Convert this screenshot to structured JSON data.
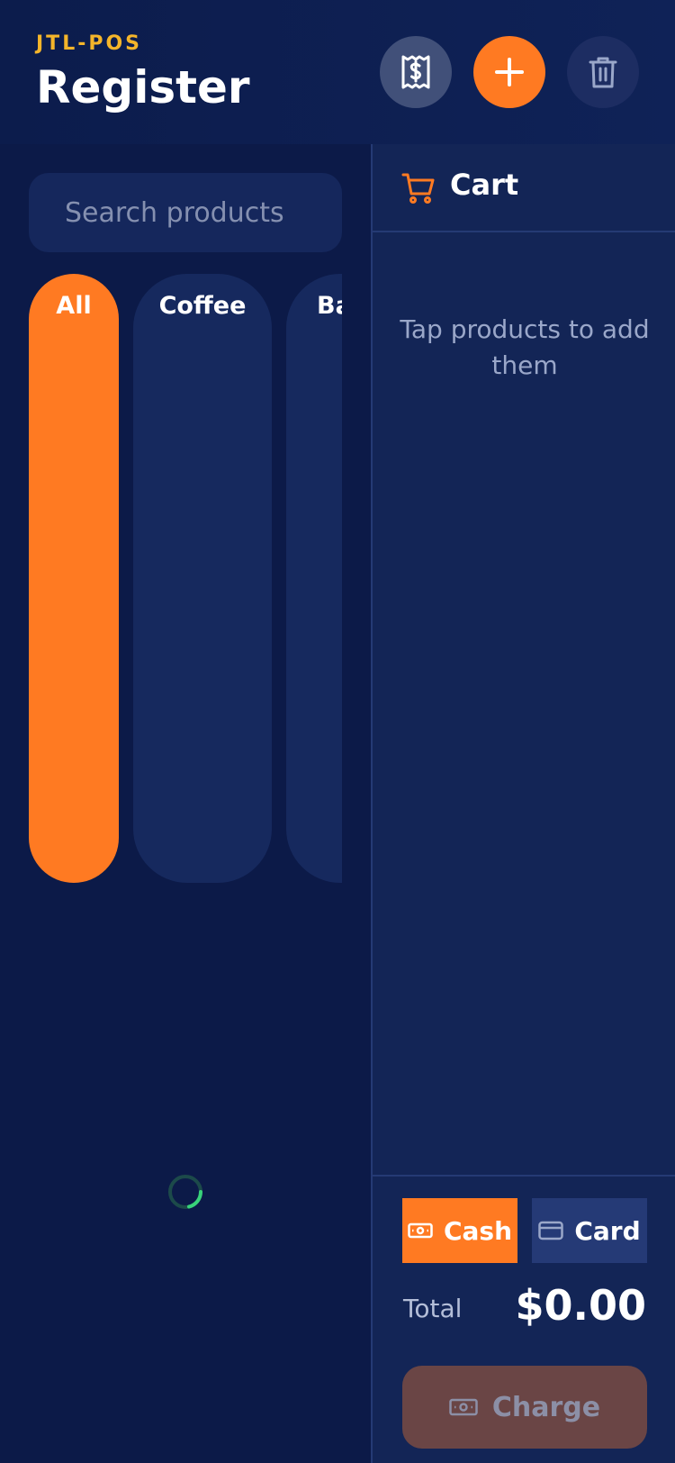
{
  "header": {
    "brand": "JTL-POS",
    "title": "Register",
    "buttons": {
      "receipt_icon": "receipt-dollar-icon",
      "add_icon": "plus-icon",
      "trash_icon": "trash-icon"
    }
  },
  "search": {
    "placeholder": "Search products",
    "value": ""
  },
  "categories": [
    {
      "label": "All",
      "active": true
    },
    {
      "label": "Coffee",
      "active": false
    },
    {
      "label": "Ba",
      "active": false
    }
  ],
  "cart": {
    "title": "Cart",
    "empty_text": "Tap products to add them",
    "payment_methods": {
      "cash": "Cash",
      "card": "Card",
      "selected": "cash"
    },
    "total_label": "Total",
    "total_value": "$0.00",
    "charge_label": "Charge"
  },
  "colors": {
    "accent": "#ff7a22",
    "brand": "#f5b52a",
    "background": "#0c1a48",
    "panel": "#132556",
    "spinner": "#38d27a"
  }
}
